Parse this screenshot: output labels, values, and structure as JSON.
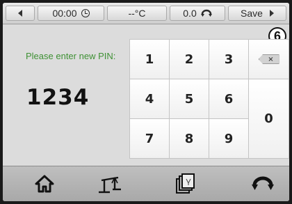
{
  "status_bar": {
    "time": "00:00",
    "temperature": "--°C",
    "speed": "0.0",
    "save_label": "Save"
  },
  "badge": "6",
  "pin_entry": {
    "prompt": "Please enter new PIN:",
    "value": "1234"
  },
  "keypad": {
    "keys": [
      "1",
      "2",
      "3",
      "4",
      "5",
      "6",
      "7",
      "8",
      "9",
      "0"
    ],
    "backspace_symbol": "×"
  },
  "icons": {
    "home": "home-icon",
    "balance": "balance-icon",
    "notes": "notes-icon",
    "rotate": "rotate-icon"
  },
  "colors": {
    "prompt": "#3f9135",
    "keypad_bg": "#e8e8e8",
    "bar_bg": "#a8a8a8"
  }
}
